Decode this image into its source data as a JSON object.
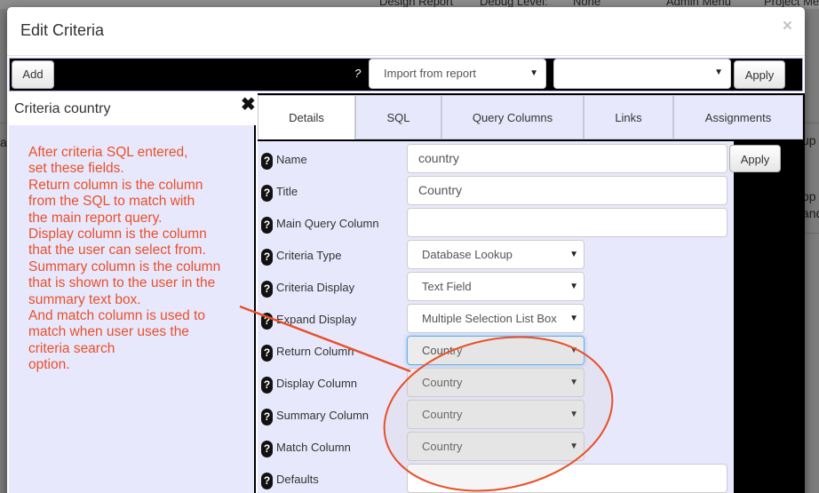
{
  "background": {
    "top_items": [
      "Design Report",
      "Debug Level:",
      "None",
      "Admin Menu",
      "Project Menu"
    ],
    "side_fragments": [
      "al",
      "up",
      "op",
      "and"
    ]
  },
  "modal": {
    "title": "Edit Criteria",
    "close_icon": "×"
  },
  "toolbar": {
    "add_label": "Add",
    "help_label": "?",
    "import_select_value": "Import from report",
    "report_select_value": "",
    "apply_label": "Apply"
  },
  "criteria_panel": {
    "title": "Criteria country",
    "remove_icon": "✖",
    "note_lines": [
      "After criteria SQL entered,",
      "set these fields.",
      "Return column is the column",
      "from the SQL to match with",
      "the main report query.",
      "Display column is the column",
      "that the user can select from.",
      "Summary column is the column",
      "that is shown to the user in the",
      "summary text box.",
      "And match column is used to",
      "match when user uses the",
      "criteria search",
      "option."
    ]
  },
  "tabs": [
    {
      "label": "Details",
      "active": true
    },
    {
      "label": "SQL",
      "active": false
    },
    {
      "label": "Query Columns",
      "active": false
    },
    {
      "label": "Links",
      "active": false
    },
    {
      "label": "Assignments",
      "active": false
    }
  ],
  "form": {
    "help_icon": "?",
    "apply_label": "Apply",
    "name": {
      "label": "Name",
      "value": "country"
    },
    "title": {
      "label": "Title",
      "value": "Country"
    },
    "main_query_column": {
      "label": "Main Query Column",
      "value": ""
    },
    "criteria_type": {
      "label": "Criteria Type",
      "value": "Database Lookup"
    },
    "criteria_display": {
      "label": "Criteria Display",
      "value": "Text Field"
    },
    "expand_display": {
      "label": "Expand Display",
      "value": "Multiple Selection List Box"
    },
    "return_column": {
      "label": "Return Column",
      "value": "Country"
    },
    "display_column": {
      "label": "Display Column",
      "value": "Country"
    },
    "summary_column": {
      "label": "Summary Column",
      "value": "Country"
    },
    "match_column": {
      "label": "Match Column",
      "value": "Country"
    },
    "defaults": {
      "label": "Defaults",
      "value": ""
    }
  },
  "annotation": {
    "color": "#e8502a",
    "shape": "ellipse-with-arrow"
  },
  "colors": {
    "panel_bg": "#e8e8fc",
    "toolbar_bg": "#000000",
    "note_text": "#e8502a"
  }
}
